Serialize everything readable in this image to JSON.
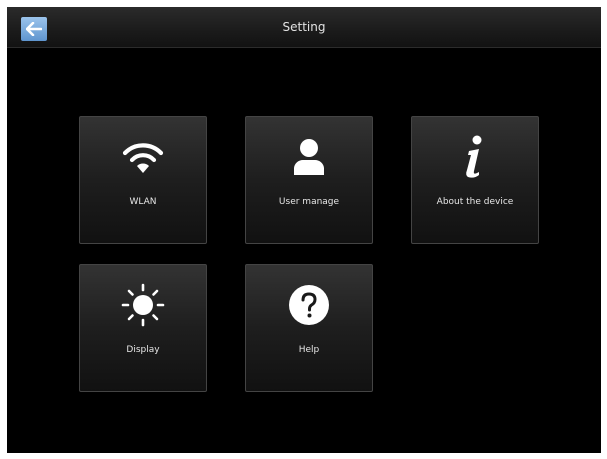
{
  "header": {
    "title": "Setting",
    "back_icon": "back-arrow-icon"
  },
  "tiles": [
    {
      "label": "WLAN",
      "icon": "wifi-icon"
    },
    {
      "label": "User manage",
      "icon": "user-icon"
    },
    {
      "label": "About the device",
      "icon": "info-icon"
    },
    {
      "label": "Display",
      "icon": "brightness-icon"
    },
    {
      "label": "Help",
      "icon": "help-icon"
    }
  ],
  "colors": {
    "background": "#000000",
    "tile": "#1e1e1e",
    "back_button": "#6c9fd6",
    "text": "#e6e6e6"
  }
}
